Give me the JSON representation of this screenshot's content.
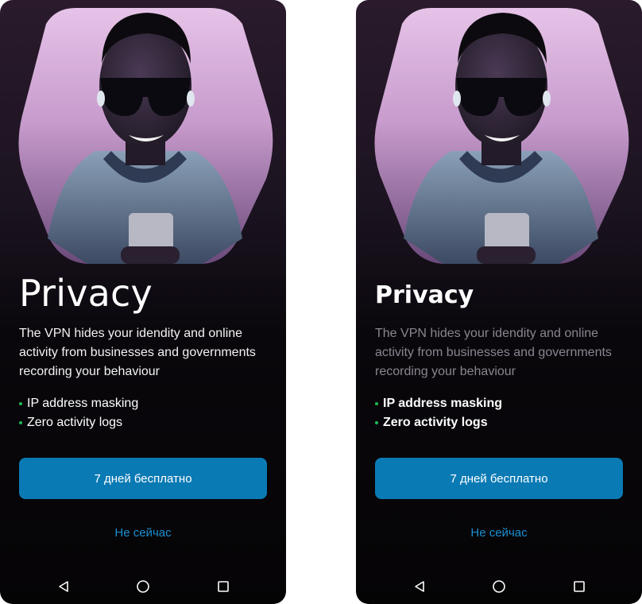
{
  "screens": [
    {
      "variant": "light-heading",
      "headline": "Privacy",
      "description": "The VPN hides your idendity and online activity from businesses and governments recording your behaviour",
      "features": [
        "IP address masking",
        "Zero activity logs"
      ],
      "primary_button": "7 дней бесплатно",
      "secondary_button": "Не сейчас"
    },
    {
      "variant": "bold-heading",
      "headline": "Privacy",
      "description": "The VPN hides your idendity and online activity from businesses and governments recording your behaviour",
      "features": [
        "IP address masking",
        "Zero activity logs"
      ],
      "primary_button": "7 дней бесплатно",
      "secondary_button": "Не сейчас"
    }
  ],
  "navbar": {
    "icons": [
      "back-triangle-icon",
      "home-circle-icon",
      "recents-square-icon"
    ]
  },
  "colors": {
    "accent_button": "#0a7ab5",
    "link": "#1a8fd1",
    "bullet": "#1db954",
    "background": "#050405"
  }
}
